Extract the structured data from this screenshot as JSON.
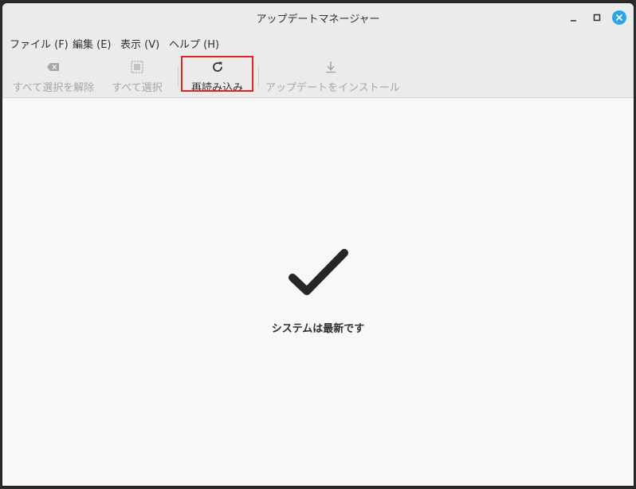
{
  "window": {
    "title": "アップデートマネージャー"
  },
  "menu": {
    "items": [
      {
        "label": "ファイル (F)"
      },
      {
        "label": "編集 (E)"
      },
      {
        "label": "表示 (V)"
      },
      {
        "label": "ヘルプ (H)"
      }
    ]
  },
  "toolbar": {
    "clear_selection": {
      "label": "すべて選択を解除",
      "icon": "backspace-icon",
      "enabled": false
    },
    "select_all": {
      "label": "すべて選択",
      "icon": "select-all-icon",
      "enabled": false
    },
    "refresh": {
      "label": "再読み込み",
      "icon": "refresh-icon",
      "enabled": true
    },
    "install": {
      "label": "アップデートをインストール",
      "icon": "download-icon",
      "enabled": false
    }
  },
  "status": {
    "message": "システムは最新です",
    "icon": "checkmark-icon"
  },
  "colors": {
    "highlight": "#e3231f",
    "close_button": "#2aa7e4"
  }
}
